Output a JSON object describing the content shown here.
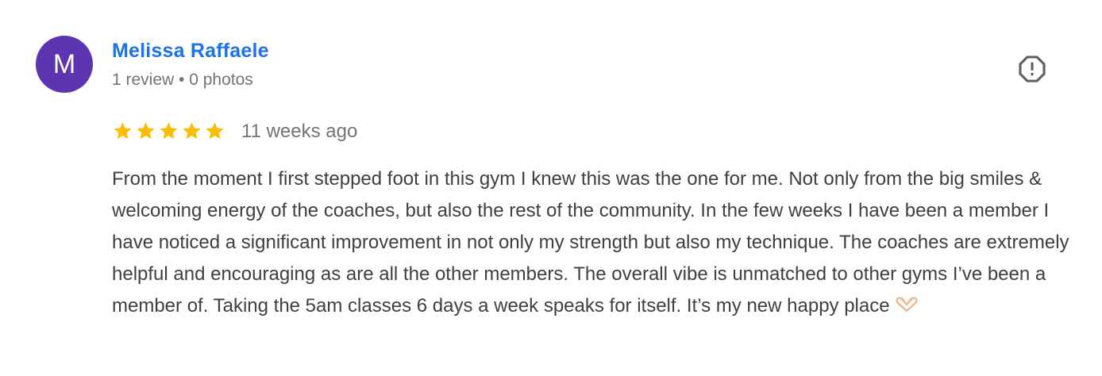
{
  "review": {
    "avatar_letter": "M",
    "avatar_color": "#5e35b1",
    "reviewer_name": "Melissa Raffaele",
    "reviewer_meta": "1 review • 0 photos",
    "rating": 5,
    "rating_max": 5,
    "star_color": "#fbbc04",
    "date": "11 weeks ago",
    "text": "From the moment I first stepped foot in this gym I knew this was the one for me. Not only from the big smiles & welcoming energy of the coaches, but also the rest of the community. In the few weeks I have been a member I have noticed a significant improvement in not only my strength but also my technique. The coaches are extremely helpful and encouraging as are all the other members. The overall vibe is unmatched to other gyms I’ve been a member of. Taking the 5am classes 6 days a week speaks for itself. It’s my new happy place",
    "trailing_emoji": "heart-hands-emoji",
    "flag_icon": "report-flag-icon"
  }
}
